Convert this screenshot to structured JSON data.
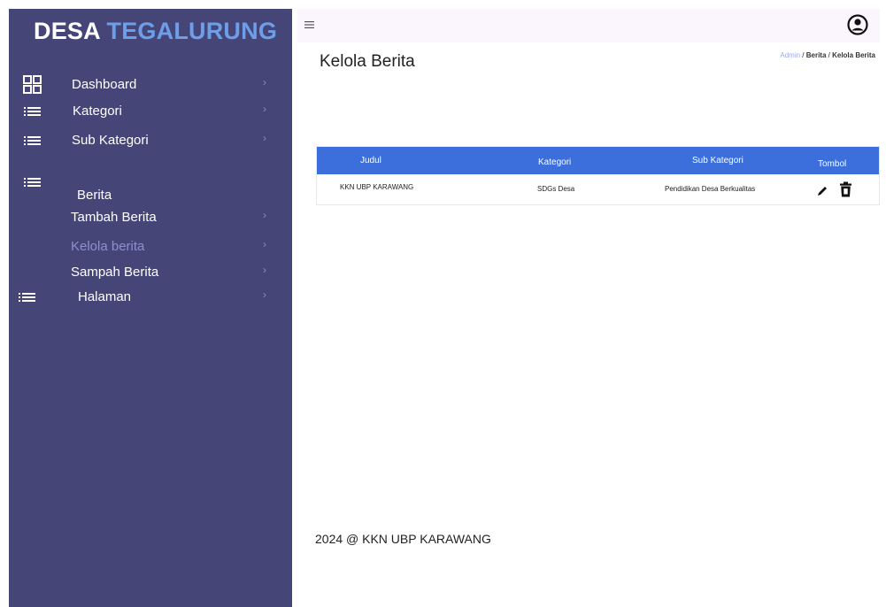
{
  "brand": {
    "part1": "DESA",
    "part2": "TEGALURUNG"
  },
  "sidebar": {
    "items": [
      {
        "label": "Dashboard",
        "icon": "grid-icon"
      },
      {
        "label": "Kategori",
        "icon": "list-icon"
      },
      {
        "label": "Sub Kategori",
        "icon": "list-icon"
      },
      {
        "label": "Berita",
        "icon": "list-icon"
      },
      {
        "label": "Tambah Berita"
      },
      {
        "label": "Kelola berita",
        "active": true
      },
      {
        "label": "Sampah Berita"
      },
      {
        "label": "Halaman",
        "icon": "list-icon"
      }
    ]
  },
  "header": {
    "menu_icon": "hamburger-icon",
    "account_icon": "account-circle-icon"
  },
  "page": {
    "title": "Kelola Berita",
    "breadcrumb": {
      "link": "Admin",
      "sep1": " / ",
      "mid": "Berita",
      "sep2": " / ",
      "current": "Kelola Berita"
    }
  },
  "table": {
    "headers": [
      "Judul",
      "Kategori",
      "Sub Kategori",
      "Tombol"
    ],
    "rows": [
      {
        "judul": "KKN UBP KARAWANG",
        "kategori": "SDGs Desa",
        "sub_kategori": "Pendidikan Desa Berkualitas"
      }
    ]
  },
  "footer": {
    "text": "2024 @ KKN UBP KARAWANG"
  },
  "colors": {
    "sidebar_bg": "#454677",
    "brand_accent": "#6e9ee8",
    "table_header": "#3c6fdc",
    "topbar_bg": "#fbf6fd"
  }
}
